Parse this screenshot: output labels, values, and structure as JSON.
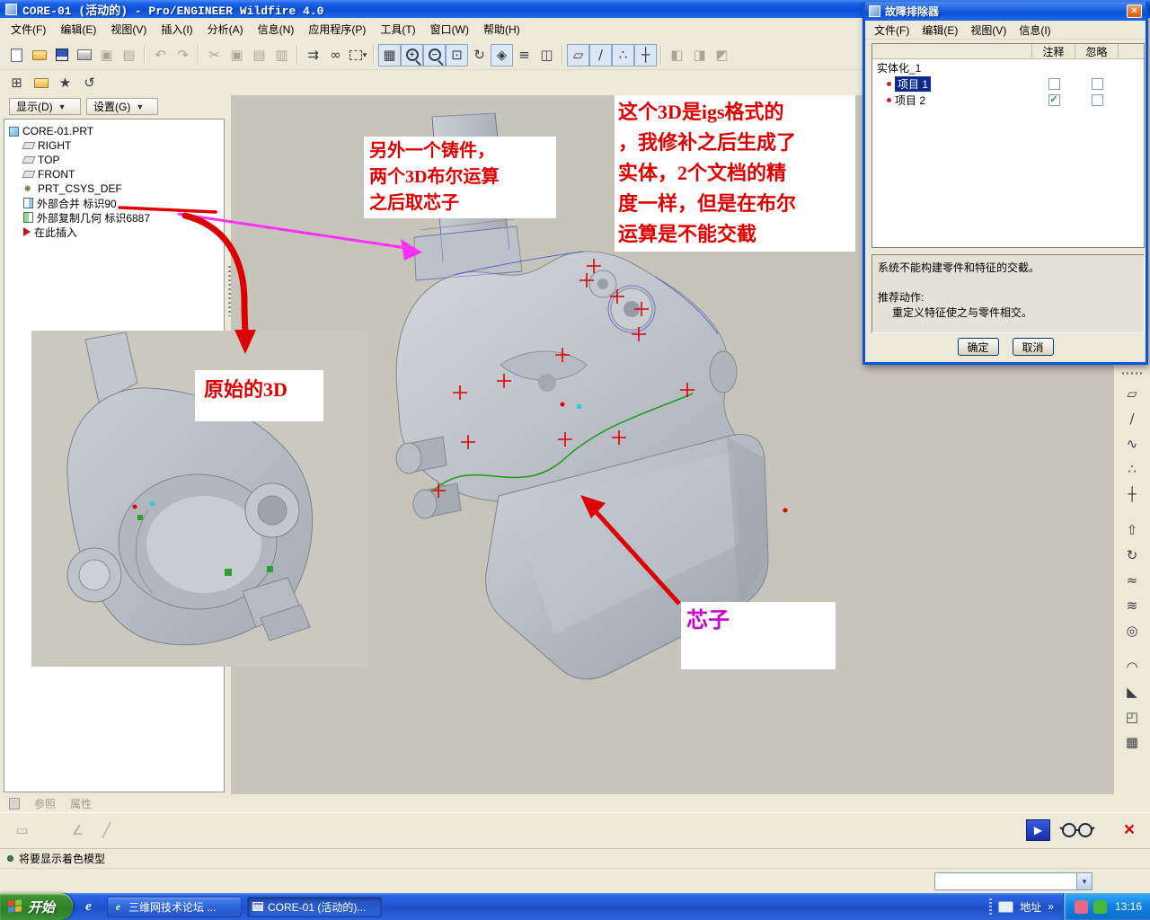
{
  "colors": {
    "annotation_red": "#DD0000",
    "annotation_magenta": "#CC00CC",
    "arrow_magenta": "#FF30FF",
    "selection_blue": "#0B2A8C",
    "canvas": "#C7C4BB"
  },
  "titlebar": {
    "title": "CORE-01 (活动的) - Pro/ENGINEER Wildfire 4.0"
  },
  "menu": {
    "items": [
      "文件(F)",
      "编辑(E)",
      "视图(V)",
      "插入(I)",
      "分析(A)",
      "信息(N)",
      "应用程序(P)",
      "工具(T)",
      "窗口(W)",
      "帮助(H)"
    ]
  },
  "toolbar": {
    "undo": "↶",
    "redo": "↷",
    "cut": "✂",
    "copy": "▣",
    "paste": "▤",
    "paste_special": "▥",
    "regenerate": "⇉",
    "find": "∞",
    "caret": "▾",
    "filter": "▦",
    "zoom_in": "+",
    "zoom_out": "−",
    "refit": "⊡",
    "repaint": "↻",
    "reorient": "◈",
    "layers": "≡",
    "view_manager": "◫",
    "datum_plane": "▱",
    "datum_axis": "∕",
    "datum_point": "∴",
    "datum_csys": "┼",
    "disp1": "◧",
    "disp2": "◨",
    "disp3": "◩"
  },
  "navigator": {
    "model_tree": "⊞",
    "favorites": "★",
    "history": "↺"
  },
  "tree": {
    "show_btn": "显示(D)",
    "settings_btn": "设置(G)",
    "caret": "▼",
    "items": [
      "CORE-01.PRT",
      "RIGHT",
      "TOP",
      "FRONT",
      "PRT_CSYS_DEF",
      "外部合并 标识90",
      "外部复制几何 标识6887",
      "在此插入"
    ]
  },
  "annotations": {
    "note1": "另外一个铸件，\n两个3D布尔运算\n之后取芯子",
    "note2": "这个3D是igs格式的\n，我修补之后生成了\n实体，2个文档的精\n度一样，但是在布尔\n运算是不能交截",
    "note3": "原始的3D",
    "note4": "芯子"
  },
  "dialog": {
    "title": "故障排除器",
    "menu": [
      "文件(F)",
      "编辑(E)",
      "视图(V)",
      "信息(I)"
    ],
    "col_annotate": "注释",
    "col_ignore": "忽略",
    "tree_root": "实体化_1",
    "item1": "项目 1",
    "item2": "项目 2",
    "check": "✓",
    "message": "系统不能构建零件和特征的交截。",
    "action_label": "推荐动作:",
    "action_text": "重定义特征使之与零件相交。",
    "ok": "确定",
    "cancel": "取消",
    "close": "×"
  },
  "right_tools": {
    "plane": "▱",
    "axis": "∕",
    "curve": "∿",
    "point": "∴",
    "csys": "┼",
    "extrude": "⇧",
    "revolve": "↻",
    "sweep": "≈",
    "blend": "≋",
    "hole": "◎",
    "round": "◠",
    "chamfer": "◣",
    "shell": "◰",
    "pattern": "▦"
  },
  "bottom": {
    "tab_ref": "参照",
    "tab_prop": "属性",
    "t1": "▭",
    "t2": "∠",
    "t3": "╱",
    "resume": "▶",
    "cancel": "×",
    "status": "将要显示着色模型"
  },
  "taskbar": {
    "start": "开始",
    "ie": "e",
    "task1": "三维网技术论坛 ...",
    "task2": "CORE-01 (活动的)...",
    "address": "地址",
    "chevron": "»",
    "clock": "13:16"
  }
}
